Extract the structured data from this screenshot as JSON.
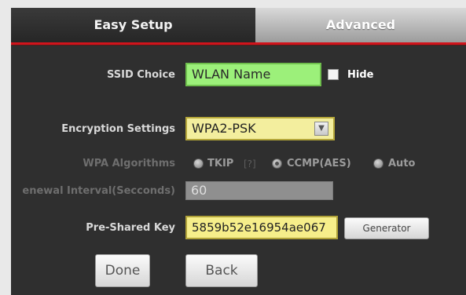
{
  "tabs": {
    "easy_setup": "Easy Setup",
    "advanced": "Advanced"
  },
  "ssid": {
    "label": "SSID Choice",
    "value": "WLAN Name",
    "hide_label": "Hide",
    "hide_checked": false
  },
  "encryption": {
    "label": "Encryption Settings",
    "selected": "WPA2-PSK"
  },
  "wpa_algorithms": {
    "label": "WPA Algorithms",
    "options": [
      "TKIP",
      "CCMP(AES)",
      "Auto"
    ],
    "selected": "CCMP(AES)",
    "help": "[?]"
  },
  "renewal": {
    "label": "enewal Interval(Secconds)",
    "value": "60"
  },
  "psk": {
    "label": "Pre-Shared Key",
    "value": "5859b52e16954ae067",
    "generator_label": "Generator"
  },
  "actions": {
    "done": "Done",
    "back": "Back"
  },
  "colors": {
    "accent_red": "#d0141c",
    "ssid_field": "#9cf07a",
    "highlight_yellow": "#f3ee9e",
    "panel": "#2f2f2f"
  }
}
